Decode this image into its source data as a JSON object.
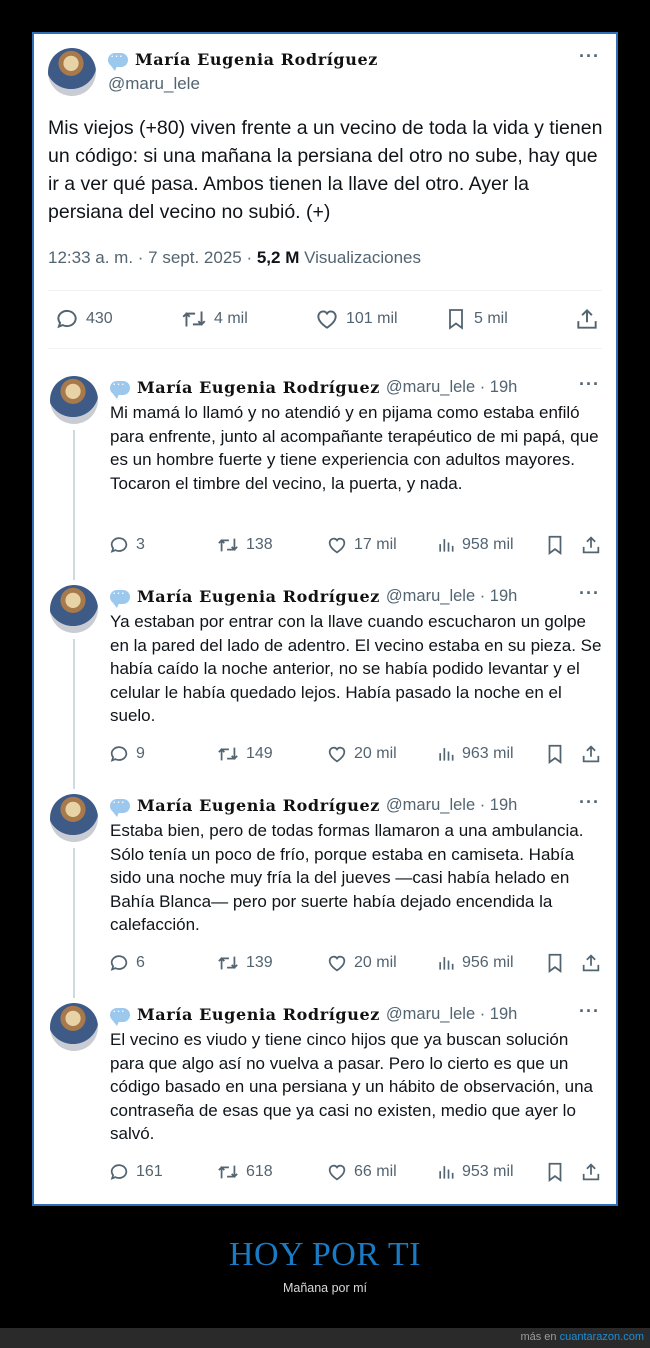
{
  "main_tweet": {
    "author_name": "María Eugenia Rodríguez",
    "handle": "@maru_lele",
    "text": "Mis viejos (+80) viven frente a un vecino de toda la vida y tienen un código: si una mañana la persiana del otro no sube, hay que ir a ver qué pasa. Ambos tienen la llave del otro. Ayer la persiana del vecino no subió. (+)",
    "time_date": "12:33 a. m. · 7 sept. 2025 · ",
    "views_count": "5,2 M",
    "views_label": "Visualizaciones",
    "replies": "430",
    "reposts": "4 mil",
    "likes": "101 mil",
    "bookmarks": "5 mil"
  },
  "replies": [
    {
      "author_name": "María Eugenia Rodríguez",
      "handle": "@maru_lele · 19h",
      "text": "Mi mamá lo llamó y no atendió y en pijama como estaba enfiló para enfrente, junto al acompañante terapéutico de mi papá, que es un hombre fuerte y tiene experiencia con adultos mayores. Tocaron el timbre del vecino, la puerta, y nada.",
      "replies": "3",
      "reposts": "138",
      "likes": "17 mil",
      "views": "958 mil"
    },
    {
      "author_name": "María Eugenia Rodríguez",
      "handle": "@maru_lele · 19h",
      "text": "Ya estaban por entrar con la llave cuando escucharon un golpe en la pared del lado de adentro. El vecino estaba en su pieza. Se había caído la noche anterior, no se había podido levantar y el celular le había quedado lejos. Había pasado la noche en el suelo.",
      "replies": "9",
      "reposts": "149",
      "likes": "20 mil",
      "views": "963 mil"
    },
    {
      "author_name": "María Eugenia Rodríguez",
      "handle": "@maru_lele · 19h",
      "text": "Estaba bien, pero de todas formas llamaron a una ambulancia. Sólo tenía un poco de frío, porque estaba en camiseta. Había sido una noche muy fría la del jueves —casi había helado en Bahía Blanca— pero por suerte había dejado encendida la calefacción.",
      "replies": "6",
      "reposts": "139",
      "likes": "20 mil",
      "views": "956 mil"
    },
    {
      "author_name": "María Eugenia Rodríguez",
      "handle": "@maru_lele · 19h",
      "text": "El vecino es viudo y tiene cinco hijos que ya buscan solución para que algo así no vuelva a pasar. Pero lo cierto es que un código basado en una persiana y un hábito de observación, una contraseña de esas que ya casi no existen, medio que ayer lo salvó.",
      "replies": "161",
      "reposts": "618",
      "likes": "66 mil",
      "views": "953 mil"
    }
  ],
  "caption": {
    "title": "HOY POR TI",
    "subtitle": "Mañana por mí"
  },
  "footer": {
    "prefix": "más en ",
    "link": "cuantarazon.com"
  },
  "colors": {
    "accent": "#1a7bc4",
    "frame_border": "#2f6fb8",
    "secondary_text": "#536471"
  },
  "icons": [
    "verified-badge-icon",
    "more-icon",
    "reply-icon",
    "repost-icon",
    "like-icon",
    "bookmark-icon",
    "share-icon",
    "views-icon"
  ]
}
